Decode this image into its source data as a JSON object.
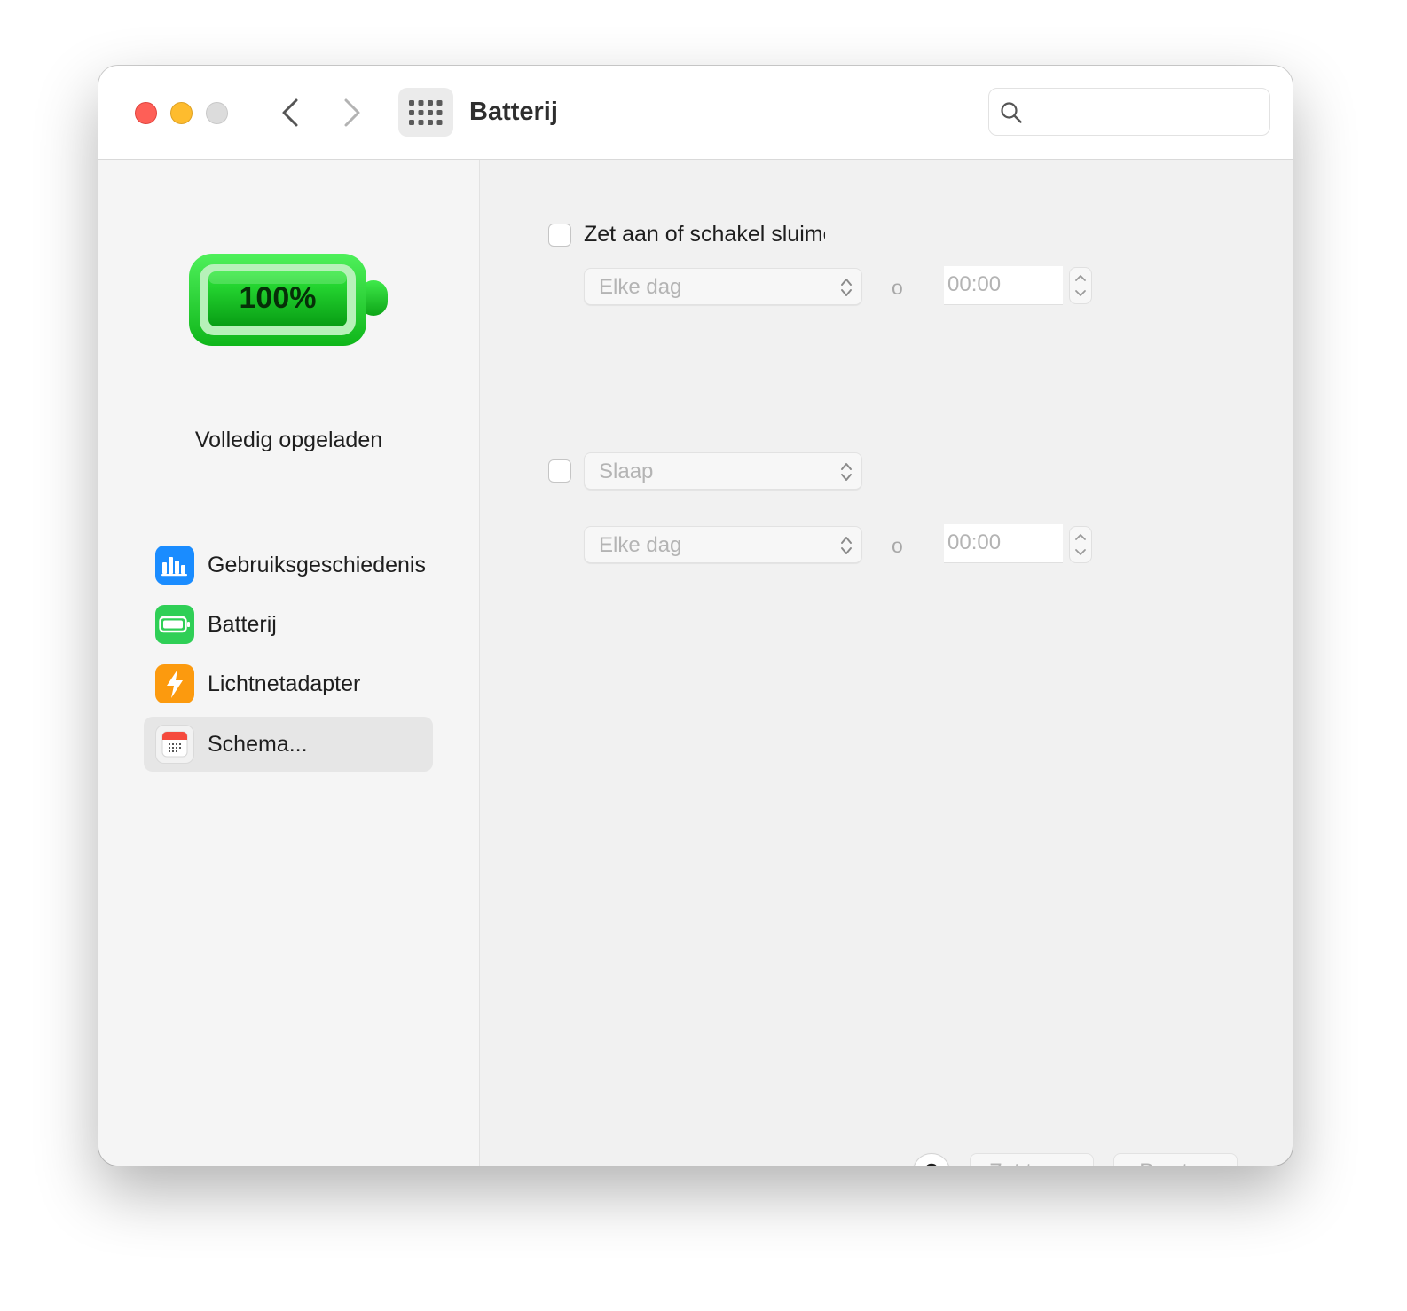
{
  "window": {
    "title": "Batterij",
    "search": {
      "placeholder": "",
      "value": ""
    }
  },
  "sidebar": {
    "battery_level": "100%",
    "battery_status": "Volledig opgeladen",
    "items": [
      {
        "label": "Gebruiksgeschiedenis",
        "icon": "bar-chart-icon",
        "color": "#1a8cff",
        "selected": false
      },
      {
        "label": "Batterij",
        "icon": "battery-icon",
        "color": "#2fcf56",
        "selected": false
      },
      {
        "label": "Lichtnetadapter",
        "icon": "lightning-icon",
        "color": "#fc9a0e",
        "selected": false
      },
      {
        "label": "Schema...",
        "icon": "calendar-icon",
        "color": "#f2f2f2",
        "selected": true
      }
    ]
  },
  "schedule": {
    "startup": {
      "checked": false,
      "label": "Zet aan of schakel sluimerstand uit",
      "day": "Elke dag",
      "at": "o",
      "time": "00:00"
    },
    "sleep": {
      "checked": false,
      "action": "Slaap",
      "day": "Elke dag",
      "at": "o",
      "time": "00:00"
    }
  },
  "footer": {
    "help": "?",
    "revert": "Zet terug",
    "apply": "Pas toe"
  },
  "colors": {
    "close": "#fe5f57",
    "minimize": "#febc2e",
    "zoom": "#dcdcdc",
    "battery_green": "#17c925"
  }
}
